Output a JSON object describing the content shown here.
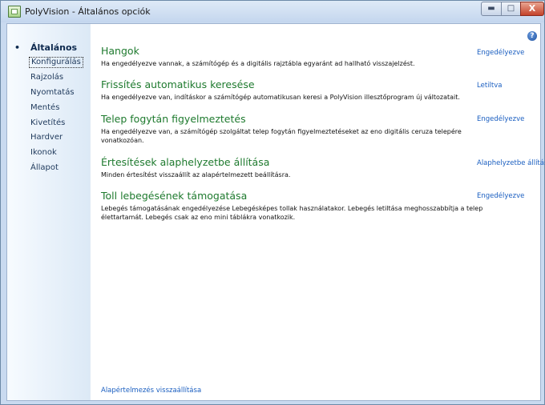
{
  "window": {
    "title": "PolyVision - Általános opciók",
    "min_label": "▬",
    "max_label": "□",
    "close_label": "X"
  },
  "help_label": "?",
  "sidebar": {
    "items": [
      {
        "label": "Általános",
        "state": "active"
      },
      {
        "label": "Konfigurálás",
        "state": "selected"
      },
      {
        "label": "Rajzolás",
        "state": "normal"
      },
      {
        "label": "Nyomtatás",
        "state": "normal"
      },
      {
        "label": "Mentés",
        "state": "normal"
      },
      {
        "label": "Kivetítés",
        "state": "normal"
      },
      {
        "label": "Hardver",
        "state": "normal"
      },
      {
        "label": "Ikonok",
        "state": "normal"
      },
      {
        "label": "Állapot",
        "state": "normal"
      }
    ]
  },
  "sections": [
    {
      "title": "Hangok",
      "description": "Ha engedélyezve vannak, a számítógép és a digitális rajztábla egyaránt ad hallható visszajelzést.",
      "action": "Engedélyezve"
    },
    {
      "title": "Frissítés automatikus keresése",
      "description": "Ha engedélyezve van, indításkor a számítógép automatikusan keresi a PolyVision illesztőprogram új változatait.",
      "action": "Letiltva"
    },
    {
      "title": "Telep fogytán figyelmeztetés",
      "description": "Ha engedélyezve van, a számítógép szolgáltat telep fogytán figyelmeztetéseket az eno digitális ceruza telepére vonatkozóan.",
      "action": "Engedélyezve"
    },
    {
      "title": "Értesítések alaphelyzetbe állítása",
      "description": "Minden értesítést visszaállít az alapértelmezett beállításra.",
      "action": "Alaphelyzetbe állítás"
    },
    {
      "title": "Toll lebegésének támogatása",
      "description": "Lebegés támogatásának engedélyezése Lebegésképes tollak használatakor. Lebegés letiltása meghosszabbítja a telep élettartamát. Lebegés csak az eno mini táblákra vonatkozik.",
      "action": "Engedélyezve"
    }
  ],
  "reset_defaults": "Alapértelmezés visszaállítása"
}
